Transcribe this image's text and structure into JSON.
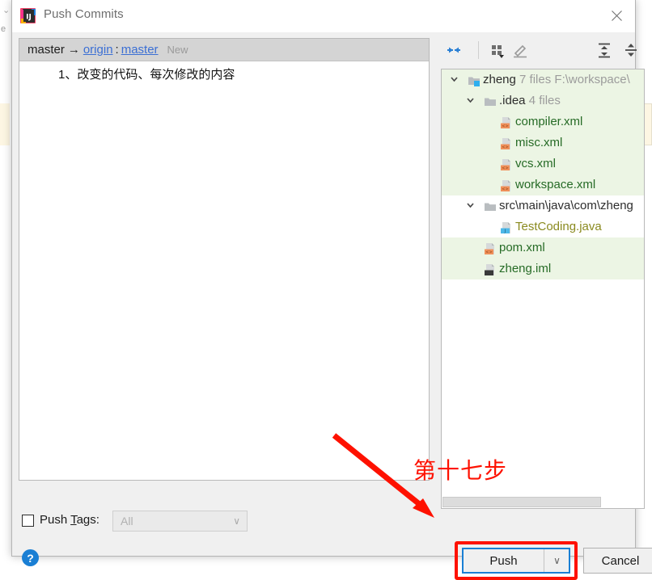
{
  "window": {
    "title": "Push Commits",
    "app_icon": "intellij-idea-icon",
    "close_icon": "close-icon"
  },
  "commits": {
    "header": {
      "local_branch": "master",
      "arrow": "→",
      "remote": "origin",
      "separator": ":",
      "remote_branch": "master",
      "badge": "New"
    },
    "rows": [
      {
        "message": "1、改变的代码、每次修改的内容"
      }
    ]
  },
  "tree_toolbar": {
    "buttons": [
      {
        "name": "collapse-all-icon",
        "title": "Collapse"
      },
      {
        "name": "group-by-icon",
        "title": "Group By"
      },
      {
        "name": "edit-icon",
        "title": "Edit Source"
      },
      {
        "name": "expand-all-icon",
        "title": "Expand All"
      },
      {
        "name": "collapse-lines-icon",
        "title": "Collapse All"
      }
    ]
  },
  "file_tree": [
    {
      "level": 0,
      "expanded": true,
      "highlight": "green",
      "icon": "module-folder-icon",
      "label": "zheng",
      "meta1": "7 files",
      "meta2": "F:\\workspace\\"
    },
    {
      "level": 1,
      "expanded": true,
      "highlight": "green",
      "icon": "folder-icon",
      "label": ".idea",
      "meta1": "4 files",
      "meta2": ""
    },
    {
      "level": 2,
      "expanded": null,
      "highlight": "green",
      "icon": "xml-file-icon",
      "label": "compiler.xml",
      "meta1": "",
      "meta2": ""
    },
    {
      "level": 2,
      "expanded": null,
      "highlight": "green",
      "icon": "xml-file-icon",
      "label": "misc.xml",
      "meta1": "",
      "meta2": ""
    },
    {
      "level": 2,
      "expanded": null,
      "highlight": "green",
      "icon": "xml-file-icon",
      "label": "vcs.xml",
      "meta1": "",
      "meta2": ""
    },
    {
      "level": 2,
      "expanded": null,
      "highlight": "green",
      "icon": "xml-file-icon",
      "label": "workspace.xml",
      "meta1": "",
      "meta2": ""
    },
    {
      "level": 1,
      "expanded": true,
      "highlight": "white",
      "icon": "folder-icon",
      "label": "src\\main\\java\\com\\zheng",
      "meta1": "",
      "meta2": ""
    },
    {
      "level": 2,
      "expanded": null,
      "highlight": "white",
      "icon": "java-file-icon",
      "label": "TestCoding.java",
      "meta1": "",
      "meta2": ""
    },
    {
      "level": 1,
      "expanded": null,
      "highlight": "green",
      "icon": "xml-file-icon",
      "label": "pom.xml",
      "meta1": "",
      "meta2": ""
    },
    {
      "level": 1,
      "expanded": null,
      "highlight": "green",
      "icon": "iml-file-icon",
      "label": "zheng.iml",
      "meta1": "",
      "meta2": ""
    }
  ],
  "annotation": {
    "text": "第十七步",
    "color": "#fe1100"
  },
  "bottom": {
    "push_tags_checked": false,
    "push_tags_label_pre": "Push ",
    "push_tags_label_mnemonic": "T",
    "push_tags_label_post": "ags:",
    "push_tags_value": "All",
    "push_tags_chevron": "∨",
    "help_label": "?",
    "push_label": "Push",
    "push_dropdown_chevron": "∨",
    "cancel_label": "Cancel"
  },
  "background": {
    "left_letter": "e",
    "left_caret": "⌄"
  },
  "colors": {
    "accent_blue": "#1a7fd4",
    "link_blue": "#3b6fd4",
    "highlight_green": "#ecf5e4",
    "annotation_red": "#fe1100",
    "file_green": "#2f8a2f",
    "xml_icon_orange": "#f0905a"
  }
}
